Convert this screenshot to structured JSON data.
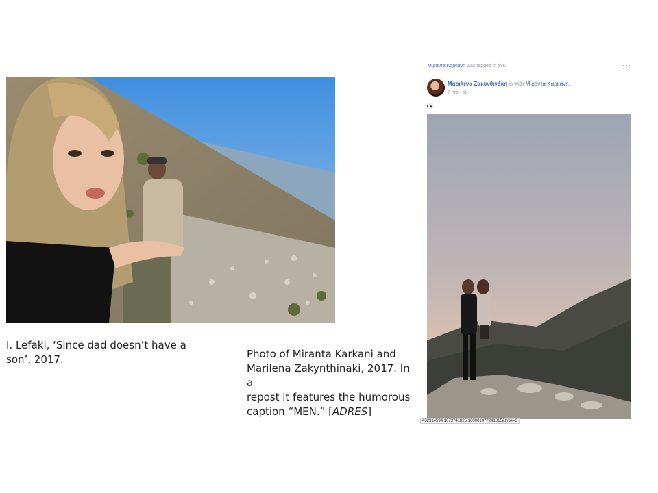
{
  "left_caption": {
    "line1": "I. Lefaki, ‘Since dad doesn’t have a",
    "line2": "son’, 2017."
  },
  "mid_caption": {
    "line1": "Photo of Miranta Karkani and",
    "line2": "Marilena Zakynthinaki, 2017. In a",
    "line3": "repost it features the humorous",
    "line4_prefix": "caption “MEN.” [",
    "line4_italic": "ADRES",
    "line4_suffix": "]"
  },
  "facebook_post": {
    "tagged_name": "Μιράντα Καρκάνη",
    "tagged_suffix": "was tagged in this.",
    "more_menu": "···",
    "author": "Μαριλένα Ζακυνθινάκη",
    "with_text": "is with",
    "with_name": "Μιράντα Καρκάνη.",
    "time": "7 hrs · ◍",
    "emoji": "👀",
    "url_text": "432314594.1073741825.100001077241815&type=3"
  }
}
